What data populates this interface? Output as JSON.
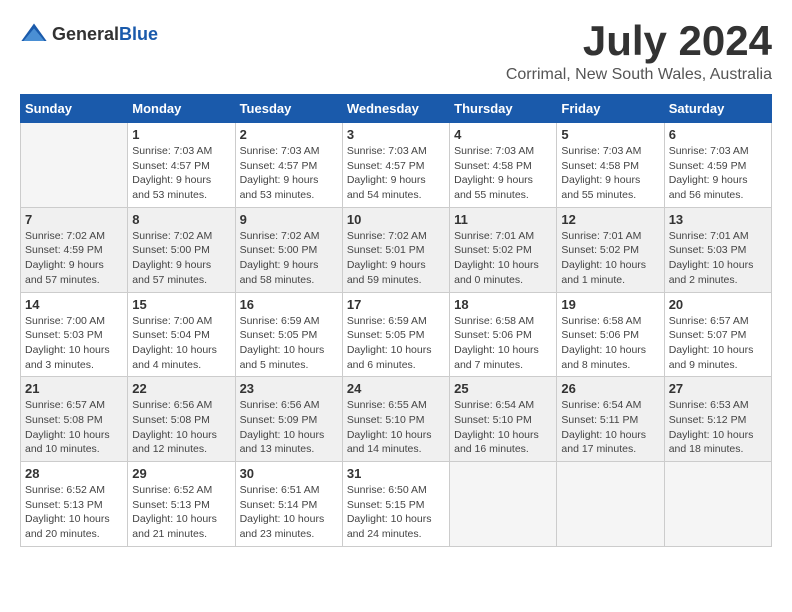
{
  "logo": {
    "general": "General",
    "blue": "Blue"
  },
  "title": {
    "month_year": "July 2024",
    "location": "Corrimal, New South Wales, Australia"
  },
  "headers": [
    "Sunday",
    "Monday",
    "Tuesday",
    "Wednesday",
    "Thursday",
    "Friday",
    "Saturday"
  ],
  "weeks": [
    {
      "shaded": false,
      "days": [
        {
          "num": "",
          "info": ""
        },
        {
          "num": "1",
          "info": "Sunrise: 7:03 AM\nSunset: 4:57 PM\nDaylight: 9 hours and 53 minutes."
        },
        {
          "num": "2",
          "info": "Sunrise: 7:03 AM\nSunset: 4:57 PM\nDaylight: 9 hours and 53 minutes."
        },
        {
          "num": "3",
          "info": "Sunrise: 7:03 AM\nSunset: 4:57 PM\nDaylight: 9 hours and 54 minutes."
        },
        {
          "num": "4",
          "info": "Sunrise: 7:03 AM\nSunset: 4:58 PM\nDaylight: 9 hours and 55 minutes."
        },
        {
          "num": "5",
          "info": "Sunrise: 7:03 AM\nSunset: 4:58 PM\nDaylight: 9 hours and 55 minutes."
        },
        {
          "num": "6",
          "info": "Sunrise: 7:03 AM\nSunset: 4:59 PM\nDaylight: 9 hours and 56 minutes."
        }
      ]
    },
    {
      "shaded": true,
      "days": [
        {
          "num": "7",
          "info": "Sunrise: 7:02 AM\nSunset: 4:59 PM\nDaylight: 9 hours and 57 minutes."
        },
        {
          "num": "8",
          "info": "Sunrise: 7:02 AM\nSunset: 5:00 PM\nDaylight: 9 hours and 57 minutes."
        },
        {
          "num": "9",
          "info": "Sunrise: 7:02 AM\nSunset: 5:00 PM\nDaylight: 9 hours and 58 minutes."
        },
        {
          "num": "10",
          "info": "Sunrise: 7:02 AM\nSunset: 5:01 PM\nDaylight: 9 hours and 59 minutes."
        },
        {
          "num": "11",
          "info": "Sunrise: 7:01 AM\nSunset: 5:02 PM\nDaylight: 10 hours and 0 minutes."
        },
        {
          "num": "12",
          "info": "Sunrise: 7:01 AM\nSunset: 5:02 PM\nDaylight: 10 hours and 1 minute."
        },
        {
          "num": "13",
          "info": "Sunrise: 7:01 AM\nSunset: 5:03 PM\nDaylight: 10 hours and 2 minutes."
        }
      ]
    },
    {
      "shaded": false,
      "days": [
        {
          "num": "14",
          "info": "Sunrise: 7:00 AM\nSunset: 5:03 PM\nDaylight: 10 hours and 3 minutes."
        },
        {
          "num": "15",
          "info": "Sunrise: 7:00 AM\nSunset: 5:04 PM\nDaylight: 10 hours and 4 minutes."
        },
        {
          "num": "16",
          "info": "Sunrise: 6:59 AM\nSunset: 5:05 PM\nDaylight: 10 hours and 5 minutes."
        },
        {
          "num": "17",
          "info": "Sunrise: 6:59 AM\nSunset: 5:05 PM\nDaylight: 10 hours and 6 minutes."
        },
        {
          "num": "18",
          "info": "Sunrise: 6:58 AM\nSunset: 5:06 PM\nDaylight: 10 hours and 7 minutes."
        },
        {
          "num": "19",
          "info": "Sunrise: 6:58 AM\nSunset: 5:06 PM\nDaylight: 10 hours and 8 minutes."
        },
        {
          "num": "20",
          "info": "Sunrise: 6:57 AM\nSunset: 5:07 PM\nDaylight: 10 hours and 9 minutes."
        }
      ]
    },
    {
      "shaded": true,
      "days": [
        {
          "num": "21",
          "info": "Sunrise: 6:57 AM\nSunset: 5:08 PM\nDaylight: 10 hours and 10 minutes."
        },
        {
          "num": "22",
          "info": "Sunrise: 6:56 AM\nSunset: 5:08 PM\nDaylight: 10 hours and 12 minutes."
        },
        {
          "num": "23",
          "info": "Sunrise: 6:56 AM\nSunset: 5:09 PM\nDaylight: 10 hours and 13 minutes."
        },
        {
          "num": "24",
          "info": "Sunrise: 6:55 AM\nSunset: 5:10 PM\nDaylight: 10 hours and 14 minutes."
        },
        {
          "num": "25",
          "info": "Sunrise: 6:54 AM\nSunset: 5:10 PM\nDaylight: 10 hours and 16 minutes."
        },
        {
          "num": "26",
          "info": "Sunrise: 6:54 AM\nSunset: 5:11 PM\nDaylight: 10 hours and 17 minutes."
        },
        {
          "num": "27",
          "info": "Sunrise: 6:53 AM\nSunset: 5:12 PM\nDaylight: 10 hours and 18 minutes."
        }
      ]
    },
    {
      "shaded": false,
      "days": [
        {
          "num": "28",
          "info": "Sunrise: 6:52 AM\nSunset: 5:13 PM\nDaylight: 10 hours and 20 minutes."
        },
        {
          "num": "29",
          "info": "Sunrise: 6:52 AM\nSunset: 5:13 PM\nDaylight: 10 hours and 21 minutes."
        },
        {
          "num": "30",
          "info": "Sunrise: 6:51 AM\nSunset: 5:14 PM\nDaylight: 10 hours and 23 minutes."
        },
        {
          "num": "31",
          "info": "Sunrise: 6:50 AM\nSunset: 5:15 PM\nDaylight: 10 hours and 24 minutes."
        },
        {
          "num": "",
          "info": ""
        },
        {
          "num": "",
          "info": ""
        },
        {
          "num": "",
          "info": ""
        }
      ]
    }
  ]
}
